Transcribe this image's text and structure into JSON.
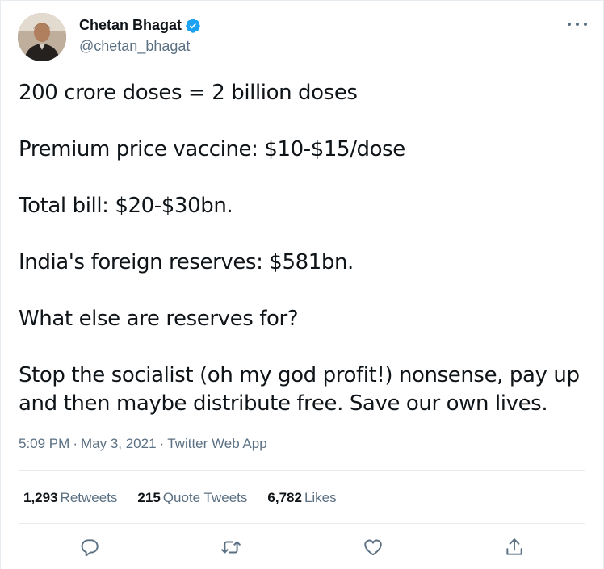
{
  "author": {
    "display_name": "Chetan Bhagat",
    "handle": "@chetan_bhagat",
    "verified": true,
    "accent": "#1da1f2"
  },
  "tweet": {
    "paragraphs": [
      "200 crore doses = 2 billion doses",
      "Premium price vaccine: $10-$15/dose",
      "Total bill: $20-$30bn.",
      "India's foreign reserves: $581bn.",
      "What else are reserves for?",
      "Stop the socialist (oh my god profit!) nonsense, pay up and then maybe distribute free. Save our own lives."
    ],
    "time": "5:09 PM",
    "date": "May 3, 2021",
    "source": "Twitter Web App"
  },
  "stats": {
    "retweets_count": "1,293",
    "retweets_label": "Retweets",
    "quote_count": "215",
    "quote_label": "Quote Tweets",
    "likes_count": "6,782",
    "likes_label": "Likes"
  },
  "icons": {
    "more": "more-horizontal-icon",
    "verified": "verified-badge-icon",
    "reply": "reply-icon",
    "retweet": "retweet-icon",
    "like": "heart-icon",
    "share": "share-icon"
  },
  "colors": {
    "text": "#0f1419",
    "secondary": "#5b7083",
    "divider": "#e6ecf0"
  }
}
